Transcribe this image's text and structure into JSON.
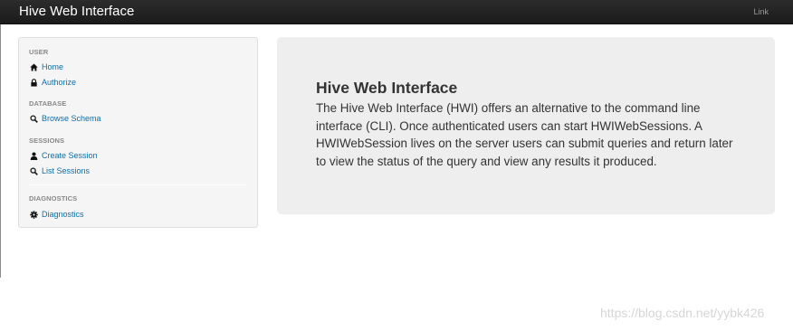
{
  "navbar": {
    "brand": "Hive Web Interface",
    "link": "Link"
  },
  "sidebar": {
    "sections": [
      {
        "header": "USER",
        "items": [
          {
            "label": "Home",
            "icon": "home-icon"
          },
          {
            "label": "Authorize",
            "icon": "lock-icon"
          }
        ]
      },
      {
        "header": "DATABASE",
        "items": [
          {
            "label": "Browse Schema",
            "icon": "search-icon"
          }
        ]
      },
      {
        "header": "SESSIONS",
        "items": [
          {
            "label": "Create Session",
            "icon": "user-icon"
          },
          {
            "label": "List Sessions",
            "icon": "search-icon"
          }
        ]
      },
      {
        "header": "DIAGNOSTICS",
        "items": [
          {
            "label": "Diagnostics",
            "icon": "gear-icon"
          }
        ]
      }
    ]
  },
  "hero": {
    "title": "Hive Web Interface",
    "text": "The Hive Web Interface (HWI) offers an alternative to the command line interface (CLI). Once authenticated users can start HWIWebSessions. A HWIWebSession lives on the server users can submit queries and return later to view the status of the query and view any results it produced."
  },
  "watermark": "https://blog.csdn.net/yybk426",
  "colors": {
    "navbar_bg": "#1b1b1b",
    "link": "#0e6ea8",
    "hero_bg": "#eeeeee",
    "sidebar_bg": "#f5f5f5"
  }
}
